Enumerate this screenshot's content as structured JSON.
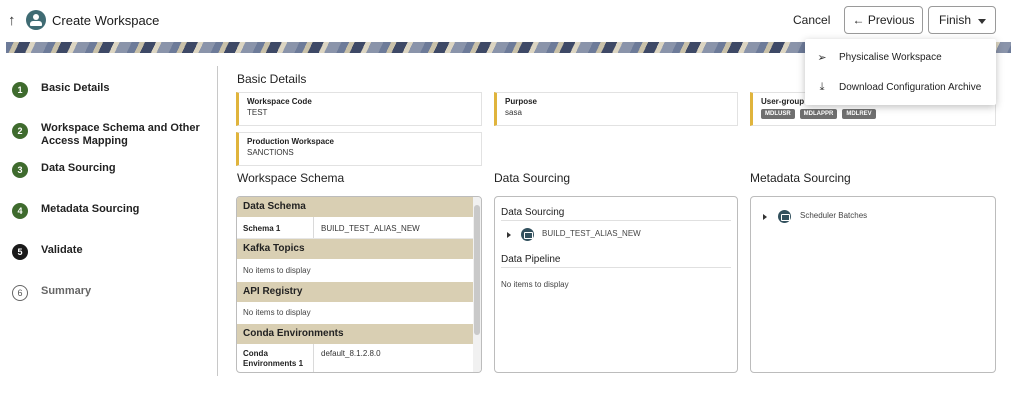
{
  "header": {
    "back_icon": "arrow-up-icon",
    "title": "Create Workspace",
    "cancel_label": "Cancel",
    "previous_label": "← Previous",
    "finish_label": "Finish"
  },
  "steps": [
    {
      "num": "1",
      "label": "Basic Details",
      "state": "done"
    },
    {
      "num": "2",
      "label": "Workspace Schema and Other Access Mapping",
      "state": "done"
    },
    {
      "num": "3",
      "label": "Data Sourcing",
      "state": "done"
    },
    {
      "num": "4",
      "label": "Metadata Sourcing",
      "state": "done"
    },
    {
      "num": "5",
      "label": "Validate",
      "state": "current"
    },
    {
      "num": "6",
      "label": "Summary",
      "state": "todo"
    }
  ],
  "basic_details": {
    "title": "Basic Details",
    "workspace_code_label": "Workspace Code",
    "workspace_code_value": "TEST",
    "purpose_label": "Purpose",
    "purpose_value": "sasa",
    "user_group_label": "User-group",
    "user_group_tags": [
      "MDLUSR",
      "MDLAPPR",
      "MDLREV"
    ],
    "production_label": "Production Workspace",
    "production_value": "SANCTIONS"
  },
  "workspace_schema": {
    "title": "Workspace Schema",
    "data_schema_header": "Data Schema",
    "schema_key": "Schema 1",
    "schema_value": "BUILD_TEST_ALIAS_NEW",
    "kafka_header": "Kafka Topics",
    "kafka_empty": "No items to display",
    "api_header": "API Registry",
    "api_empty": "No items to display",
    "conda_header": "Conda Environments",
    "conda_key": "Conda Environments 1",
    "conda_value": "default_8.1.2.8.0"
  },
  "data_sourcing": {
    "title": "Data Sourcing",
    "sub_title": "Data Sourcing",
    "item": "BUILD_TEST_ALIAS_NEW",
    "pipeline_title": "Data Pipeline",
    "pipeline_empty": "No items to display"
  },
  "metadata_sourcing": {
    "title": "Metadata Sourcing",
    "item": "Scheduler Batches"
  },
  "finish_menu": [
    {
      "icon": "paper-plane-icon",
      "label": "Physicalise Workspace"
    },
    {
      "icon": "download-icon",
      "label": "Download Configuration Archive"
    }
  ],
  "colors": {
    "accent": "#e0b43c",
    "group_header": "#d9cfb3",
    "step_done": "#3f6b2e"
  }
}
